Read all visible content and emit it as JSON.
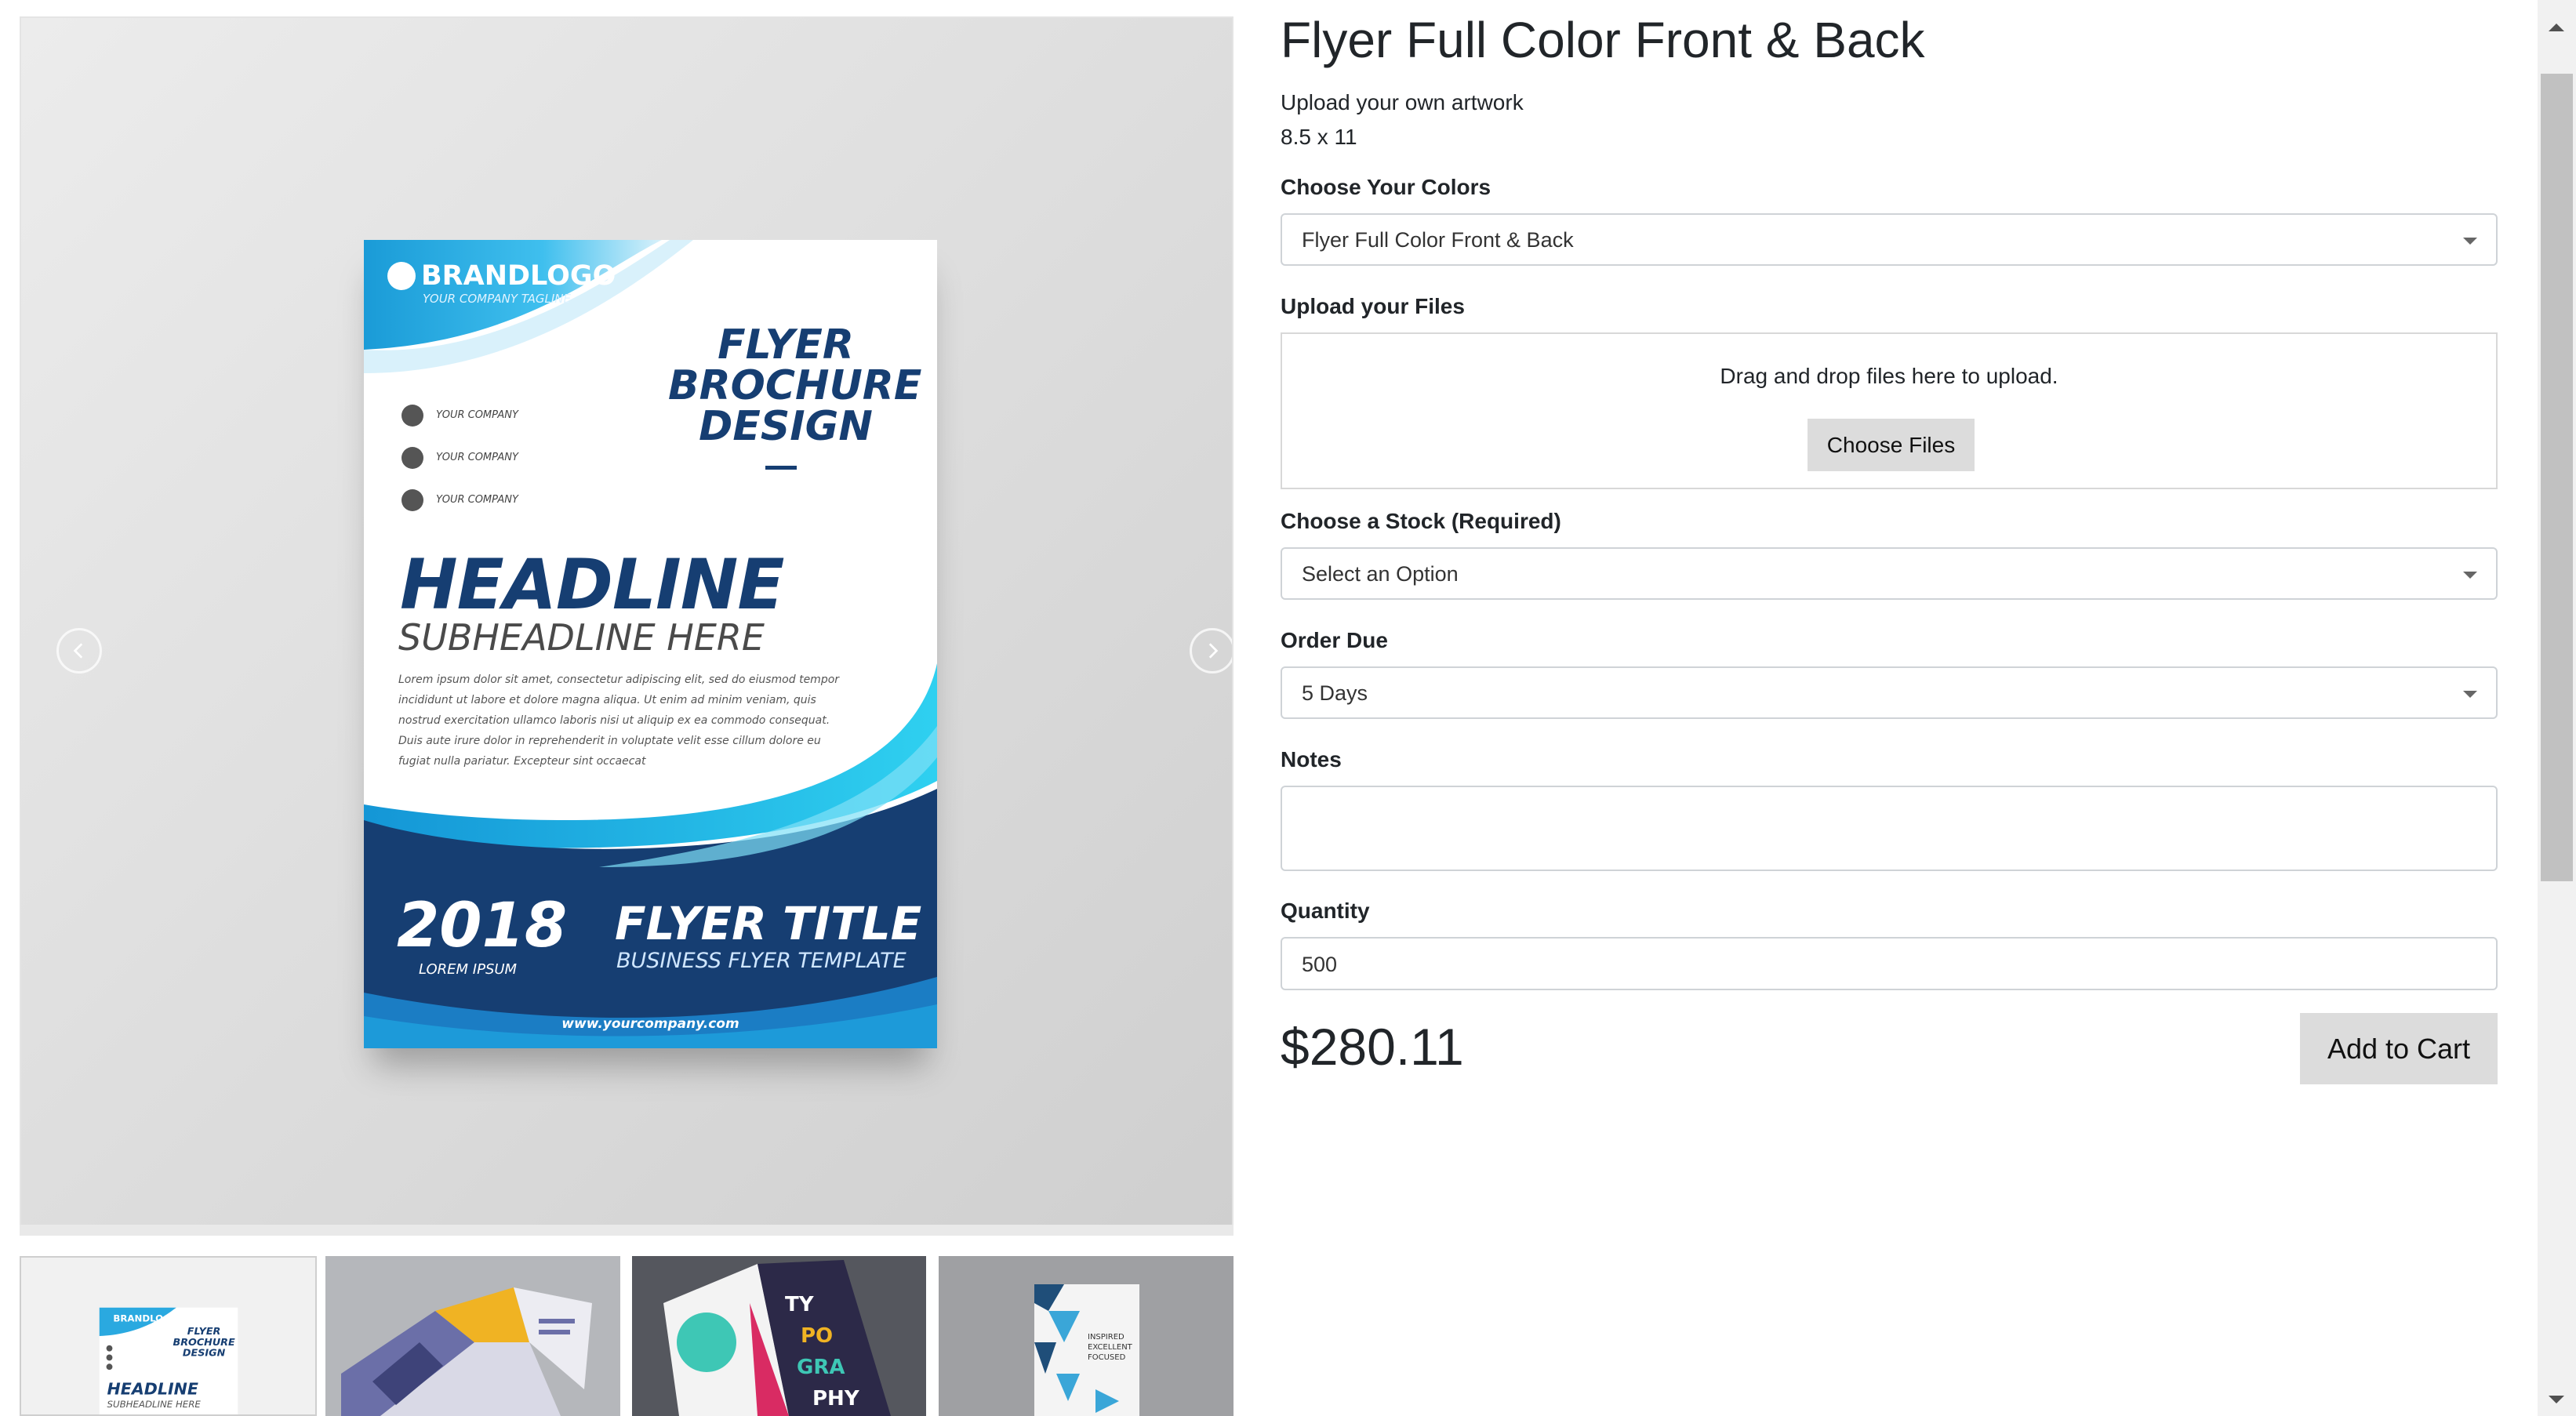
{
  "product": {
    "title": "Flyer Full Color Front & Back",
    "subtitle": "Upload your own artwork",
    "size": "8.5 x 11",
    "price": "$280.11",
    "add_to_cart_label": "Add to Cart"
  },
  "form": {
    "colors": {
      "label": "Choose Your Colors",
      "value": "Flyer Full Color Front & Back"
    },
    "files": {
      "label": "Upload your Files",
      "dropzone_text": "Drag and drop files here to upload.",
      "button_label": "Choose Files"
    },
    "stock": {
      "label": "Choose a Stock (Required)",
      "value": "Select an Option"
    },
    "due": {
      "label": "Order Due",
      "value": "5 Days"
    },
    "notes": {
      "label": "Notes",
      "value": ""
    },
    "quantity": {
      "label": "Quantity",
      "value": "500"
    }
  },
  "gallery": {
    "flyer": {
      "brand": "BRANDLOGO",
      "tagline": "YOUR COMPANY TAGLINE",
      "title_lines": [
        "FLYER",
        "BROCHURE",
        "DESIGN"
      ],
      "info_items": [
        "YOUR COMPANY",
        "YOUR COMPANY",
        "YOUR COMPANY"
      ],
      "headline": "HEADLINE",
      "subheadline": "SUBHEADLINE HERE",
      "lorem": "Lorem ipsum dolor sit amet, consectetur adipiscing elit, sed do eiusmod tempor incididunt ut labore et dolore magna aliqua. Ut enim ad minim veniam, quis nostrud exercitation ullamco laboris nisi ut aliquip ex ea commodo consequat. Duis aute irure dolor in reprehenderit in voluptate velit esse cillum dolore eu fugiat nulla pariatur. Excepteur sint occaecat",
      "year": "2018",
      "year_sub": "LOREM IPSUM",
      "footer_title": "FLYER TITLE",
      "footer_sub": "BUSINESS FLYER TEMPLATE",
      "website": "www.yourcompany.com"
    },
    "thumb1": {
      "brand": "BRANDLOGO",
      "title_lines": [
        "FLYER",
        "BROCHURE",
        "DESIGN"
      ],
      "headline": "HEADLINE",
      "subheadline": "SUBHEADLINE HERE"
    },
    "thumb3": {
      "letters": [
        "TY",
        "PO",
        "GRA",
        "PHY"
      ]
    },
    "thumb4": {
      "lines": [
        "INSPIRED",
        "EXCELLENT",
        "FOCUSED"
      ]
    },
    "icons": {
      "prev": "chevron-left-icon",
      "next": "chevron-right-icon"
    }
  },
  "colors": {
    "brand_dark": "#163e72",
    "brand_light": "#29abe2",
    "button_gray": "#dcdcdc"
  }
}
